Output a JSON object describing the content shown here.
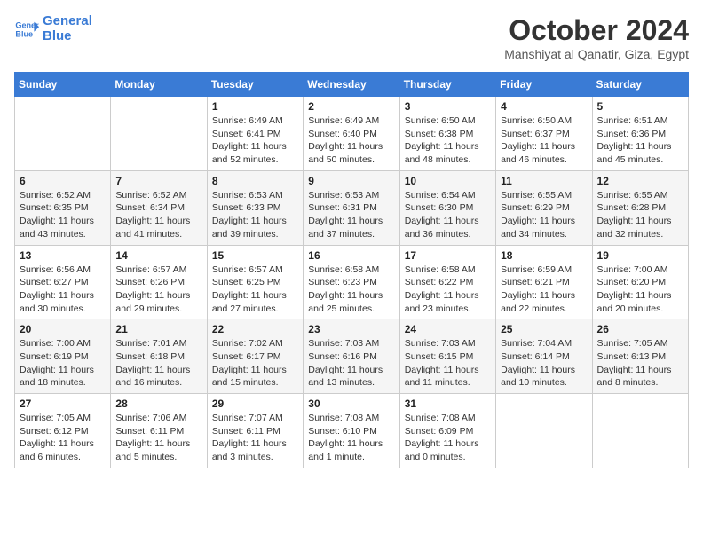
{
  "logo": {
    "line1": "General",
    "line2": "Blue"
  },
  "title": "October 2024",
  "subtitle": "Manshiyat al Qanatir, Giza, Egypt",
  "headers": [
    "Sunday",
    "Monday",
    "Tuesday",
    "Wednesday",
    "Thursday",
    "Friday",
    "Saturday"
  ],
  "weeks": [
    [
      {
        "day": "",
        "content": ""
      },
      {
        "day": "",
        "content": ""
      },
      {
        "day": "1",
        "content": "Sunrise: 6:49 AM\nSunset: 6:41 PM\nDaylight: 11 hours\nand 52 minutes."
      },
      {
        "day": "2",
        "content": "Sunrise: 6:49 AM\nSunset: 6:40 PM\nDaylight: 11 hours\nand 50 minutes."
      },
      {
        "day": "3",
        "content": "Sunrise: 6:50 AM\nSunset: 6:38 PM\nDaylight: 11 hours\nand 48 minutes."
      },
      {
        "day": "4",
        "content": "Sunrise: 6:50 AM\nSunset: 6:37 PM\nDaylight: 11 hours\nand 46 minutes."
      },
      {
        "day": "5",
        "content": "Sunrise: 6:51 AM\nSunset: 6:36 PM\nDaylight: 11 hours\nand 45 minutes."
      }
    ],
    [
      {
        "day": "6",
        "content": "Sunrise: 6:52 AM\nSunset: 6:35 PM\nDaylight: 11 hours\nand 43 minutes."
      },
      {
        "day": "7",
        "content": "Sunrise: 6:52 AM\nSunset: 6:34 PM\nDaylight: 11 hours\nand 41 minutes."
      },
      {
        "day": "8",
        "content": "Sunrise: 6:53 AM\nSunset: 6:33 PM\nDaylight: 11 hours\nand 39 minutes."
      },
      {
        "day": "9",
        "content": "Sunrise: 6:53 AM\nSunset: 6:31 PM\nDaylight: 11 hours\nand 37 minutes."
      },
      {
        "day": "10",
        "content": "Sunrise: 6:54 AM\nSunset: 6:30 PM\nDaylight: 11 hours\nand 36 minutes."
      },
      {
        "day": "11",
        "content": "Sunrise: 6:55 AM\nSunset: 6:29 PM\nDaylight: 11 hours\nand 34 minutes."
      },
      {
        "day": "12",
        "content": "Sunrise: 6:55 AM\nSunset: 6:28 PM\nDaylight: 11 hours\nand 32 minutes."
      }
    ],
    [
      {
        "day": "13",
        "content": "Sunrise: 6:56 AM\nSunset: 6:27 PM\nDaylight: 11 hours\nand 30 minutes."
      },
      {
        "day": "14",
        "content": "Sunrise: 6:57 AM\nSunset: 6:26 PM\nDaylight: 11 hours\nand 29 minutes."
      },
      {
        "day": "15",
        "content": "Sunrise: 6:57 AM\nSunset: 6:25 PM\nDaylight: 11 hours\nand 27 minutes."
      },
      {
        "day": "16",
        "content": "Sunrise: 6:58 AM\nSunset: 6:23 PM\nDaylight: 11 hours\nand 25 minutes."
      },
      {
        "day": "17",
        "content": "Sunrise: 6:58 AM\nSunset: 6:22 PM\nDaylight: 11 hours\nand 23 minutes."
      },
      {
        "day": "18",
        "content": "Sunrise: 6:59 AM\nSunset: 6:21 PM\nDaylight: 11 hours\nand 22 minutes."
      },
      {
        "day": "19",
        "content": "Sunrise: 7:00 AM\nSunset: 6:20 PM\nDaylight: 11 hours\nand 20 minutes."
      }
    ],
    [
      {
        "day": "20",
        "content": "Sunrise: 7:00 AM\nSunset: 6:19 PM\nDaylight: 11 hours\nand 18 minutes."
      },
      {
        "day": "21",
        "content": "Sunrise: 7:01 AM\nSunset: 6:18 PM\nDaylight: 11 hours\nand 16 minutes."
      },
      {
        "day": "22",
        "content": "Sunrise: 7:02 AM\nSunset: 6:17 PM\nDaylight: 11 hours\nand 15 minutes."
      },
      {
        "day": "23",
        "content": "Sunrise: 7:03 AM\nSunset: 6:16 PM\nDaylight: 11 hours\nand 13 minutes."
      },
      {
        "day": "24",
        "content": "Sunrise: 7:03 AM\nSunset: 6:15 PM\nDaylight: 11 hours\nand 11 minutes."
      },
      {
        "day": "25",
        "content": "Sunrise: 7:04 AM\nSunset: 6:14 PM\nDaylight: 11 hours\nand 10 minutes."
      },
      {
        "day": "26",
        "content": "Sunrise: 7:05 AM\nSunset: 6:13 PM\nDaylight: 11 hours\nand 8 minutes."
      }
    ],
    [
      {
        "day": "27",
        "content": "Sunrise: 7:05 AM\nSunset: 6:12 PM\nDaylight: 11 hours\nand 6 minutes."
      },
      {
        "day": "28",
        "content": "Sunrise: 7:06 AM\nSunset: 6:11 PM\nDaylight: 11 hours\nand 5 minutes."
      },
      {
        "day": "29",
        "content": "Sunrise: 7:07 AM\nSunset: 6:11 PM\nDaylight: 11 hours\nand 3 minutes."
      },
      {
        "day": "30",
        "content": "Sunrise: 7:08 AM\nSunset: 6:10 PM\nDaylight: 11 hours\nand 1 minute."
      },
      {
        "day": "31",
        "content": "Sunrise: 7:08 AM\nSunset: 6:09 PM\nDaylight: 11 hours\nand 0 minutes."
      },
      {
        "day": "",
        "content": ""
      },
      {
        "day": "",
        "content": ""
      }
    ]
  ]
}
